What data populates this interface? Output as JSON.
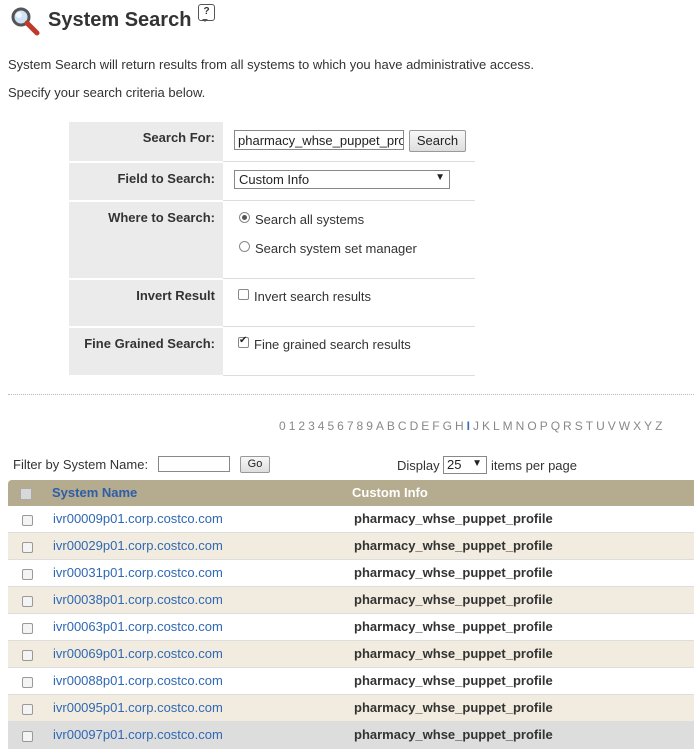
{
  "header": {
    "title": "System Search",
    "help_icon": "question-mark-bubble-icon",
    "search_icon": "magnifying-glass-icon"
  },
  "description": {
    "line1": "System Search will return results from all systems to which you have administrative access.",
    "line2": "Specify your search criteria below."
  },
  "form": {
    "search_for_label": "Search For:",
    "search_value": "pharmacy_whse_puppet_pro",
    "search_button": "Search",
    "field_label": "Field to Search:",
    "field_value": "Custom Info",
    "where_label": "Where to Search:",
    "where_opt1": "Search all systems",
    "where_opt2": "Search system set manager",
    "invert_label": "Invert Result",
    "invert_opt": "Invert search results",
    "fine_label": "Fine Grained Search:",
    "fine_opt": "Fine grained search results"
  },
  "alphabet": [
    "0",
    "1",
    "2",
    "3",
    "4",
    "5",
    "6",
    "7",
    "8",
    "9",
    "A",
    "B",
    "C",
    "D",
    "E",
    "F",
    "G",
    "H",
    "I",
    "J",
    "K",
    "L",
    "M",
    "N",
    "O",
    "P",
    "Q",
    "R",
    "S",
    "T",
    "U",
    "V",
    "W",
    "X",
    "Y",
    "Z"
  ],
  "filter": {
    "label": "Filter by System Name:",
    "go": "Go",
    "display": "Display",
    "per_page_value": "25",
    "items_per_page": "items per page"
  },
  "table": {
    "col1": "System Name",
    "col2": "Custom Info",
    "rows": [
      {
        "name": "ivr00009p01.corp.costco.com",
        "info": "pharmacy_whse_puppet_profile"
      },
      {
        "name": "ivr00029p01.corp.costco.com",
        "info": "pharmacy_whse_puppet_profile"
      },
      {
        "name": "ivr00031p01.corp.costco.com",
        "info": "pharmacy_whse_puppet_profile"
      },
      {
        "name": "ivr00038p01.corp.costco.com",
        "info": "pharmacy_whse_puppet_profile"
      },
      {
        "name": "ivr00063p01.corp.costco.com",
        "info": "pharmacy_whse_puppet_profile"
      },
      {
        "name": "ivr00069p01.corp.costco.com",
        "info": "pharmacy_whse_puppet_profile"
      },
      {
        "name": "ivr00088p01.corp.costco.com",
        "info": "pharmacy_whse_puppet_profile"
      },
      {
        "name": "ivr00095p01.corp.costco.com",
        "info": "pharmacy_whse_puppet_profile"
      },
      {
        "name": "ivr00097p01.corp.costco.com",
        "info": "pharmacy_whse_puppet_profile"
      }
    ]
  }
}
